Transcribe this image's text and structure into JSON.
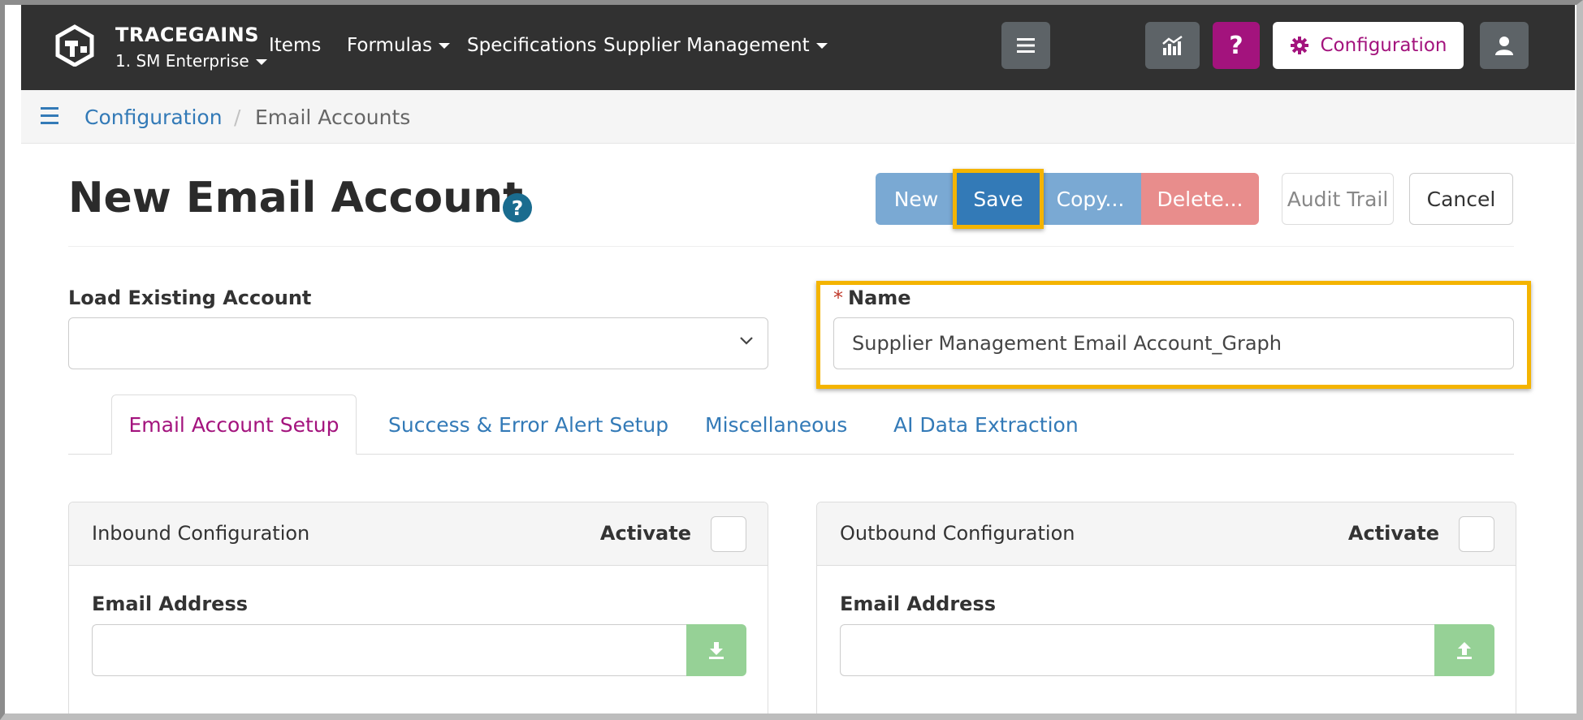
{
  "navbar": {
    "brand_name": "TRACEGAINS",
    "brand_sub": "1. SM Enterprise",
    "links": {
      "items": "Items",
      "formulas": "Formulas",
      "specifications": "Specifications",
      "supplier_management": "Supplier Management"
    },
    "help_symbol": "?",
    "configuration_label": "Configuration",
    "icons": [
      "tracegains-logo",
      "menu-icon",
      "report-chart-icon",
      "help-icon",
      "gear-icon",
      "user-icon"
    ],
    "accent_color": "#a3137d"
  },
  "breadcrumb": {
    "root": "Configuration",
    "separator": "/",
    "current": "Email Accounts"
  },
  "page": {
    "title": "New Email Account",
    "help_symbol": "?"
  },
  "actions": {
    "new": "New",
    "save": "Save",
    "copy": "Copy...",
    "delete": "Delete...",
    "audit_trail": "Audit Trail",
    "cancel": "Cancel"
  },
  "form": {
    "load_existing_label": "Load Existing Account",
    "load_existing_value": "",
    "name_required_mark": "*",
    "name_label": "Name",
    "name_value": "Supplier Management Email Account_Graph"
  },
  "tabs": {
    "email_account_setup": "Email Account Setup",
    "success_error_alert_setup": "Success & Error Alert Setup",
    "miscellaneous": "Miscellaneous",
    "ai_data_extraction": "AI Data Extraction",
    "active": "Email Account Setup"
  },
  "inbound": {
    "title": "Inbound Configuration",
    "activate_label": "Activate",
    "email_label": "Email Address",
    "email_value": ""
  },
  "outbound": {
    "title": "Outbound Configuration",
    "activate_label": "Activate",
    "email_label": "Email Address",
    "email_value": ""
  },
  "highlight_color": "#f4b400"
}
